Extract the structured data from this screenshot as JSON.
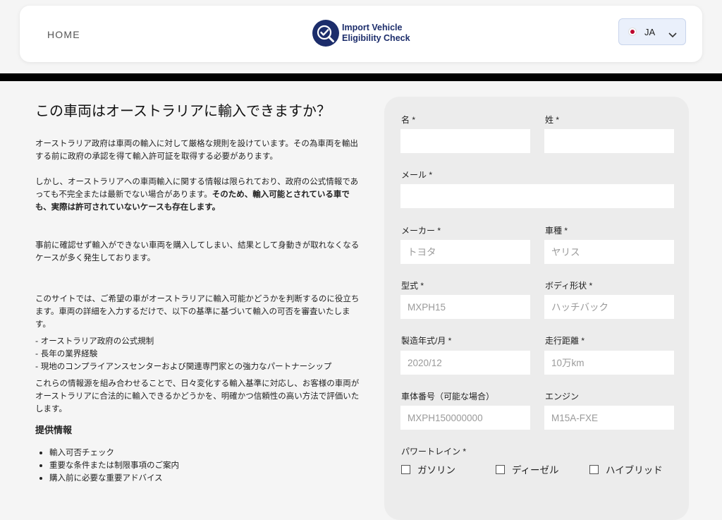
{
  "header": {
    "nav_home": "HOME",
    "logo_line1": "Import Vehicle",
    "logo_line2": "Eligibility Check",
    "language_code": "JA"
  },
  "main": {
    "title": "この車両はオーストラリアに輸入できますか？",
    "para1": "オーストラリア政府は車両の輸入に対して厳格な規則を設けています。その為車両を輸出する前に政府の承認を得て輸入許可証を取得する必要があります。",
    "para2_normal": "しかし、オーストラリアへの車両輸入に関する情報は限られており、政府の公式情報であっても不完全または最新でない場合があります。",
    "para2_bold": "そのため、輸入可能とされている車でも、実際は許可されていないケースも存在します。",
    "para3": "事前に確認せず輸入ができない車両を購入してしまい、結果として身動きが取れなくなるケースが多く発生しております。",
    "para4": "このサイトでは、ご希望の車がオーストラリアに輸入可能かどうかを判断するのに役立ちます。車両の詳細を入力するだけで、以下の基準に基づいて輸入の可否を審査いたします。",
    "criteria": [
      "- オーストラリア政府の公式規制",
      "- 長年の業界経験",
      "- 現地のコンプライアンスセンターおよび関連専門家との強力なパートナーシップ"
    ],
    "para5": "これらの情報源を組み合わせることで、日々変化する輸入基準に対応し、お客様の車両がオーストラリアに合法的に輸入できるかどうかを、明確かつ信頼性の高い方法で評価いたします。",
    "provided_heading": "提供情報",
    "provided_items": [
      "輸入可否チェック",
      "重要な条件または制限事項のご案内",
      "購入前に必要な重要アドバイス"
    ]
  },
  "form": {
    "first_name_label": "名 *",
    "last_name_label": "姓 *",
    "email_label": "メール *",
    "maker_label": "メーカー *",
    "maker_placeholder": "トヨタ",
    "model_label": "車種 *",
    "model_placeholder": "ヤリス",
    "type_label": "型式 *",
    "type_placeholder": "MXPH15",
    "body_label": "ボディ形状 *",
    "body_placeholder": "ハッチバック",
    "year_label": "製造年式/月 *",
    "year_placeholder": "2020/12",
    "mileage_label": "走行距離 *",
    "mileage_placeholder": "10万km",
    "chassis_label": "車体番号（可能な場合）",
    "chassis_placeholder": "MXPH150000000",
    "engine_label": "エンジン",
    "engine_placeholder": "M15A-FXE",
    "powertrain_label": "パワートレイン *",
    "powertrain_options": [
      "ガソリン",
      "ディーゼル",
      "ハイブリッド"
    ]
  },
  "colors": {
    "brand_navy": "#1c2d6b",
    "divider": "#000000",
    "form_bg": "#ececec"
  }
}
